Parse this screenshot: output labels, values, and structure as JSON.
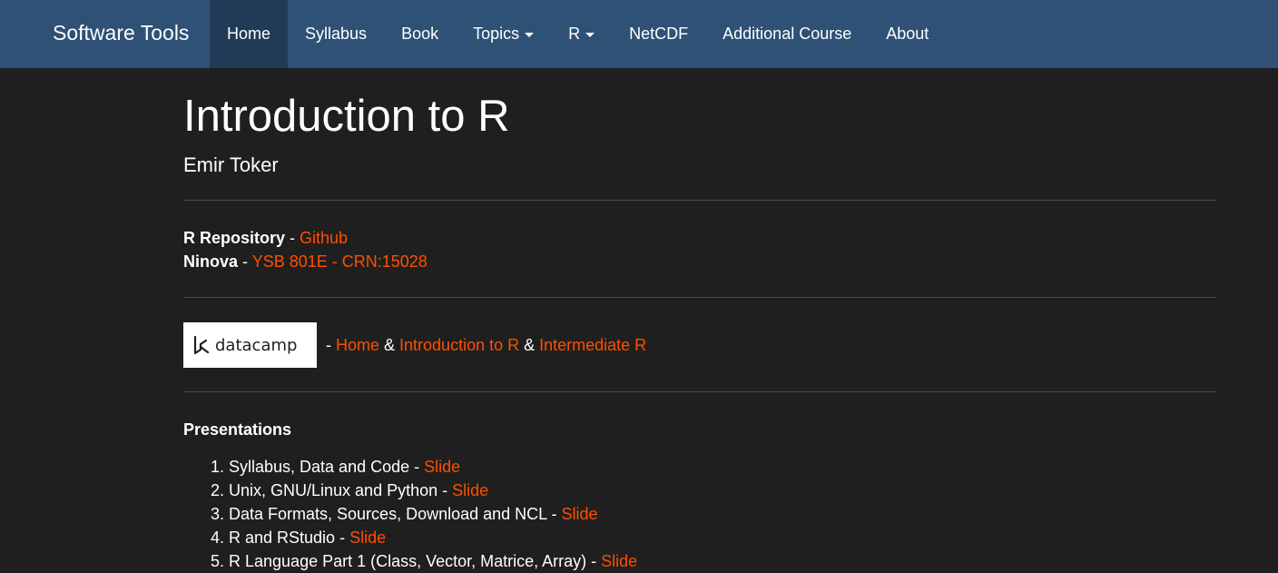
{
  "navbar": {
    "brand": "Software Tools",
    "items": [
      {
        "label": "Home",
        "active": true,
        "dropdown": false
      },
      {
        "label": "Syllabus",
        "active": false,
        "dropdown": false
      },
      {
        "label": "Book",
        "active": false,
        "dropdown": false
      },
      {
        "label": "Topics",
        "active": false,
        "dropdown": true
      },
      {
        "label": "R",
        "active": false,
        "dropdown": true
      },
      {
        "label": "NetCDF",
        "active": false,
        "dropdown": false
      },
      {
        "label": "Additional Course",
        "active": false,
        "dropdown": false
      },
      {
        "label": "About",
        "active": false,
        "dropdown": false
      }
    ]
  },
  "page": {
    "title": "Introduction to R",
    "author": "Emir Toker"
  },
  "repo": {
    "label": "R Repository",
    "sep": " - ",
    "link": "Github"
  },
  "ninova": {
    "label": "Ninova",
    "sep": " - ",
    "link": "YSB 801E - CRN:15028"
  },
  "datacamp": {
    "logo_text": "datacamp",
    "sep": " - ",
    "home": "Home",
    "amp1": " & ",
    "intro": "Introduction to R",
    "amp2": " & ",
    "intermediate": "Intermediate R"
  },
  "presentations": {
    "title": "Presentations",
    "items": [
      {
        "text": "Syllabus, Data and Code - ",
        "link": "Slide"
      },
      {
        "text": "Unix, GNU/Linux and Python - ",
        "link": "Slide"
      },
      {
        "text": "Data Formats, Sources, Download and NCL - ",
        "link": "Slide"
      },
      {
        "text": "R and RStudio - ",
        "link": "Slide"
      },
      {
        "text": "R Language Part 1 (Class, Vector, Matrice, Array) - ",
        "link": "Slide"
      }
    ]
  },
  "colors": {
    "navbar_bg": "#2e5175",
    "navbar_active": "#213b57",
    "page_bg": "#1f1f1f",
    "link": "#ff4f00"
  }
}
